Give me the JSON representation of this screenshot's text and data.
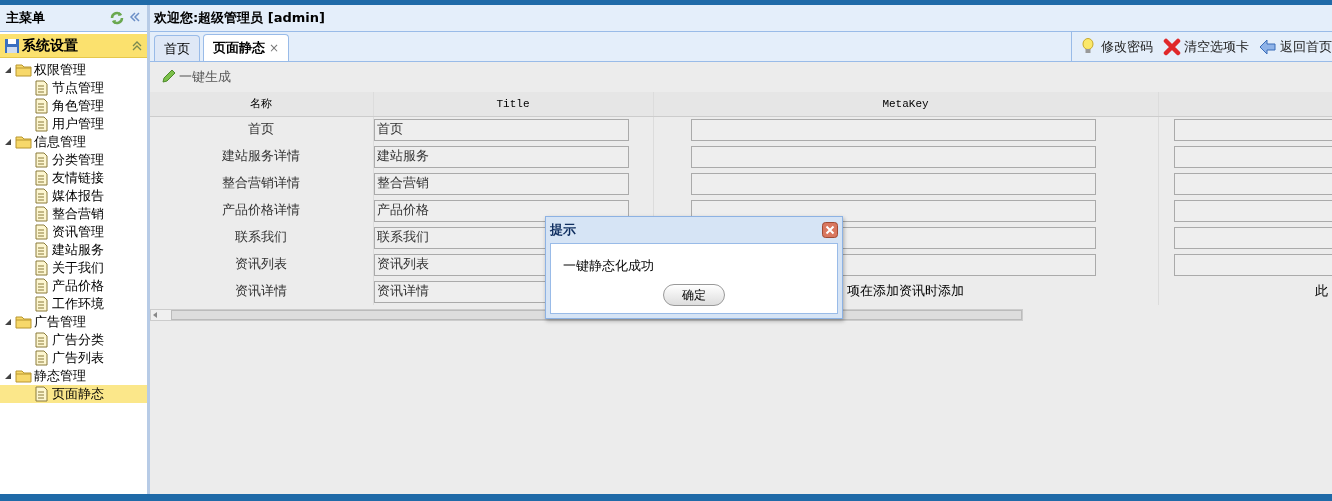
{
  "header": {
    "menu_title": "主菜单",
    "welcome": "欢迎您:超级管理员 [admin]"
  },
  "sidebar": {
    "section": {
      "label": "系统设置",
      "expanded": true
    },
    "tree": [
      {
        "label": "权限管理",
        "expanded": true,
        "children": [
          {
            "label": "节点管理",
            "selected": false
          },
          {
            "label": "角色管理",
            "selected": false
          },
          {
            "label": "用户管理",
            "selected": false
          }
        ]
      },
      {
        "label": "信息管理",
        "expanded": true,
        "children": [
          {
            "label": "分类管理",
            "selected": false
          },
          {
            "label": "友情链接",
            "selected": false
          },
          {
            "label": "媒体报告",
            "selected": false
          },
          {
            "label": "整合营销",
            "selected": false
          },
          {
            "label": "资讯管理",
            "selected": false
          },
          {
            "label": "建站服务",
            "selected": false
          },
          {
            "label": "关于我们",
            "selected": false
          },
          {
            "label": "产品价格",
            "selected": false
          },
          {
            "label": "工作环境",
            "selected": false
          }
        ]
      },
      {
        "label": "广告管理",
        "expanded": true,
        "children": [
          {
            "label": "广告分类",
            "selected": false
          },
          {
            "label": "广告列表",
            "selected": false
          }
        ]
      },
      {
        "label": "静态管理",
        "expanded": true,
        "children": [
          {
            "label": "页面静态",
            "selected": true
          }
        ]
      }
    ]
  },
  "tabs": [
    {
      "label": "首页",
      "selected": false
    },
    {
      "label": "页面静态",
      "selected": true,
      "close": "×"
    }
  ],
  "toolbar": [
    {
      "kind": "bulb",
      "label": "修改密码"
    },
    {
      "kind": "cross",
      "label": "清空选项卡"
    },
    {
      "kind": "back",
      "label": "返回首页"
    }
  ],
  "action": {
    "label": "一键生成"
  },
  "table": {
    "columns": [
      "名称",
      "Title",
      "MetaKey"
    ],
    "rows": [
      {
        "name": "首页",
        "title": "首页",
        "metakey": {
          "kind": "field"
        },
        "column_4": {
          "kind": "field"
        }
      },
      {
        "name": "建站服务详情",
        "title": "建站服务",
        "metakey": {
          "kind": "field"
        },
        "column_4": {
          "kind": "field"
        }
      },
      {
        "name": "整合营销详情",
        "title": "整合营销",
        "metakey": {
          "kind": "field"
        },
        "column_4": {
          "kind": "field"
        }
      },
      {
        "name": "产品价格详情",
        "title": "产品价格",
        "metakey": {
          "kind": "field"
        },
        "column_4": {
          "kind": "field"
        }
      },
      {
        "name": "联系我们",
        "title": "联系我们",
        "metakey": {
          "kind": "field"
        },
        "column_4": {
          "kind": "field"
        }
      },
      {
        "name": "资讯列表",
        "title": "资讯列表",
        "metakey": {
          "kind": "field"
        },
        "column_4": {
          "kind": "field"
        }
      },
      {
        "name": "资讯详情",
        "title": "资讯详情",
        "metakey": {
          "kind": "text",
          "text": "项在添加资讯时添加"
        },
        "column_4": {
          "kind": "text",
          "text": "此"
        }
      }
    ]
  },
  "dialog": {
    "title": "提示",
    "message": "一键静态化成功",
    "button": "确定"
  }
}
